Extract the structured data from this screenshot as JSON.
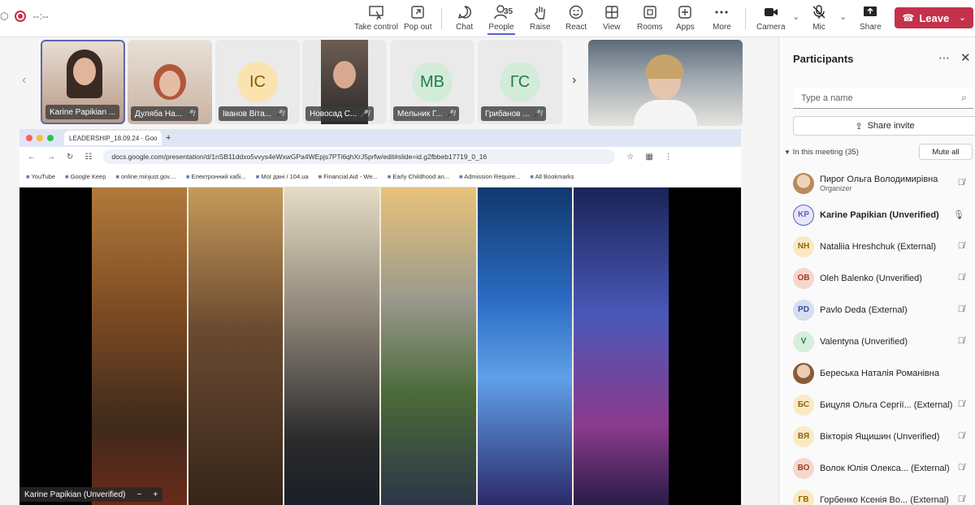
{
  "toolbar": {
    "timer": "--:--",
    "take_control": "Take control",
    "pop_out": "Pop out",
    "chat": "Chat",
    "people": "People",
    "people_count": "35",
    "raise": "Raise",
    "react": "React",
    "view": "View",
    "rooms": "Rooms",
    "apps": "Apps",
    "more": "More",
    "camera": "Camera",
    "mic": "Mic",
    "share": "Share",
    "leave": "Leave"
  },
  "tiles": [
    {
      "label": "Karine Papikian ..."
    },
    {
      "label": "Дуляба На..."
    },
    {
      "initials": "IC",
      "label": "Іванов Віта..."
    },
    {
      "label": "Новосад С..."
    },
    {
      "initials": "MB",
      "label": "Мельник Г..."
    },
    {
      "initials": "ГС",
      "label": "Грибанов ..."
    }
  ],
  "browser": {
    "tab_title": "LEADERSHIP_18.09.24 - Goo",
    "url": "docs.google.com/presentation/d/1nSB11ddxo5vvys4eWxwGPa4WEpjs7PTi6qhXrJ5prfw/edit#slide=id.g2fbbeb17719_0_16",
    "bookmarks": [
      "YouTube",
      "Google Keep",
      "online.minjust.gov....",
      "Електронний кабі...",
      "Мої дані / 104.ua",
      "Financial Aid - We...",
      "Early Childhood an...",
      "Admission Require..."
    ],
    "all_bookmarks": "All Bookmarks"
  },
  "share_label": "Karine Papikian (Unverified)",
  "participants": {
    "title": "Participants",
    "search_placeholder": "Type a name",
    "invite": "Share invite",
    "in_meeting": "In this meeting (35)",
    "mute_all": "Mute all",
    "list": [
      {
        "initials": "",
        "name": "Пирог Ольга Володимирівна",
        "sub": "Organizer",
        "color": "#e8c7a8"
      },
      {
        "initials": "KP",
        "name": "Karine Papikian (Unverified)",
        "sub": "",
        "color": "#e9e6f7"
      },
      {
        "initials": "NH",
        "name": "Nataliia Hreshchuk (External)",
        "sub": "",
        "color": "#fbe9c6"
      },
      {
        "initials": "OB",
        "name": "Oleh Balenko (Unverified)",
        "sub": "",
        "color": "#f6d7cd"
      },
      {
        "initials": "PD",
        "name": "Pavlo Deda (External)",
        "sub": "",
        "color": "#d7def2"
      },
      {
        "initials": "V",
        "name": "Valentyna (Unverified)",
        "sub": "",
        "color": "#d8eddc"
      },
      {
        "initials": "",
        "name": "Береська Наталія Романівна",
        "sub": "",
        "color": "#d9b9a6"
      },
      {
        "initials": "БС",
        "name": "Бицуля Ольга Сергії... (External)",
        "sub": "",
        "color": "#fbe9c6"
      },
      {
        "initials": "ВЯ",
        "name": "Вікторія Ящишин (Unverified)",
        "sub": "",
        "color": "#fbe9c6"
      },
      {
        "initials": "ВО",
        "name": "Волок Юлія Олекса... (External)",
        "sub": "",
        "color": "#f6d7cd"
      },
      {
        "initials": "ГВ",
        "name": "Горбенко Ксенія Во... (External)",
        "sub": "",
        "color": "#fbe9c6"
      }
    ]
  }
}
